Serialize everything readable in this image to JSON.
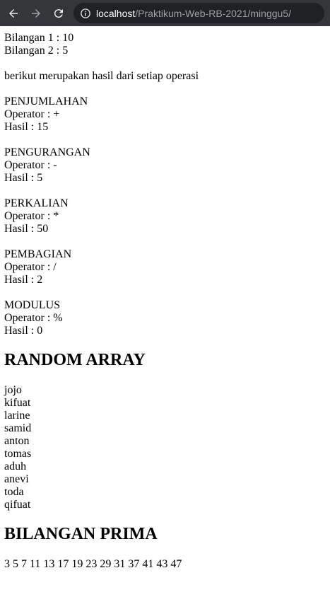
{
  "browser": {
    "url_host": "localhost",
    "url_path": "/Praktikum-Web-RB-2021/minggu5/"
  },
  "intro": {
    "bil1": "Bilangan 1 : 10",
    "bil2": "Bilangan 2 : 5",
    "desc": "berikut merupakan hasil dari setiap operasi"
  },
  "operations": [
    {
      "title": "PENJUMLAHAN",
      "operator": "Operator : +",
      "result": "Hasil : 15"
    },
    {
      "title": "PENGURANGAN",
      "operator": "Operator : -",
      "result": "Hasil : 5"
    },
    {
      "title": "PERKALIAN",
      "operator": "Operator : *",
      "result": "Hasil : 50"
    },
    {
      "title": "PEMBAGIAN",
      "operator": "Operator : /",
      "result": "Hasil : 2"
    },
    {
      "title": "MODULUS",
      "operator": "Operator : %",
      "result": "Hasil : 0"
    }
  ],
  "random": {
    "heading": "RANDOM ARRAY",
    "items": [
      "jojo",
      "kifuat",
      "larine",
      "samid",
      "anton",
      "tomas",
      "aduh",
      "anevi",
      "toda",
      "qifuat"
    ]
  },
  "prime": {
    "heading": "BILANGAN PRIMA",
    "list": "3 5 7 11 13 17 19 23 29 31 37 41 43 47"
  }
}
